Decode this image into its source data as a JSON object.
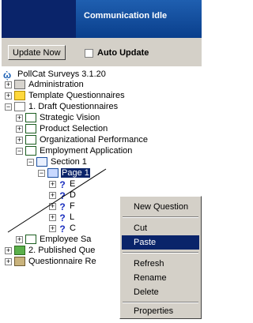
{
  "header": {
    "status": "Communication Idle"
  },
  "toolbar": {
    "update_now": "Update Now",
    "auto_update": "Auto Update"
  },
  "tree": {
    "root": "PollCat Surveys 3.1.20",
    "administration": "Administration",
    "template_questionnaires": "Template Questionnaires",
    "draft_questionnaires": "1. Draft Questionnaires",
    "strategic_vision": "Strategic Vision",
    "product_selection": "Product Selection",
    "organizational_performance": "Organizational Performance",
    "employment_application": "Employment Application",
    "section1": "Section 1",
    "page1": "Page 1",
    "q_letters": [
      "E",
      "D",
      "F",
      "L",
      "C"
    ],
    "employee_survey": "Employee Sa",
    "published_questionnaires": "2. Published Que",
    "questionnaire_results": "Questionnaire Re"
  },
  "context_menu": {
    "items": [
      "New Question",
      "Cut",
      "Paste",
      "Refresh",
      "Rename",
      "Delete",
      "Properties"
    ],
    "highlighted": "Paste"
  }
}
